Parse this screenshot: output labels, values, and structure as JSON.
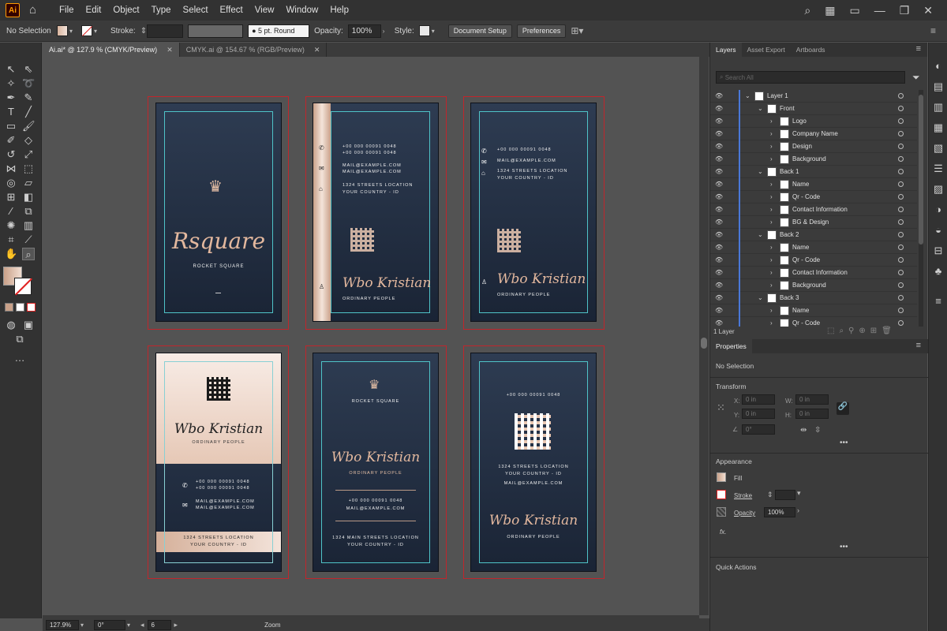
{
  "menu": {
    "items": [
      "File",
      "Edit",
      "Object",
      "Type",
      "Select",
      "Effect",
      "View",
      "Window",
      "Help"
    ],
    "logo": "Ai"
  },
  "control": {
    "selection": "No Selection",
    "stroke_label": "Stroke:",
    "brush": "5 pt. Round",
    "opacity_label": "Opacity:",
    "opacity": "100%",
    "style_label": "Style:",
    "doc_setup": "Document Setup",
    "preferences": "Preferences"
  },
  "tabs": [
    {
      "label": "Ai.ai* @ 127.9 % (CMYK/Preview)",
      "active": true
    },
    {
      "label": "CMYK.ai @ 154.67 % (RGB/Preview)",
      "active": false
    }
  ],
  "cards": {
    "brand": "Rsquare",
    "brand_sub": "ROCKET SQUARE",
    "phone1": "+00 000 00091 0048",
    "phone2": "+00 000 00091 0048",
    "mail1": "MAIL@EXAMPLE.COM",
    "mail2": "MAIL@EXAMPLE.COM",
    "addr1": "1324 STREETS LOCATION",
    "addr2": "YOUR COUNTRY - ID",
    "name": "Wbo Kristian",
    "title": "ORDINARY PEOPLE",
    "addr_main": "1324 MAIN STREETS LOCATION"
  },
  "status": {
    "zoom": "127.9%",
    "rotate": "0°",
    "artboard": "6",
    "tool": "Zoom"
  },
  "layers": {
    "tabs": [
      "Layers",
      "Asset Export",
      "Artboards"
    ],
    "search_placeholder": "Search All",
    "rows": [
      {
        "name": "Layer 1",
        "level": 0
      },
      {
        "name": "Front",
        "level": 1
      },
      {
        "name": "Logo",
        "level": 2
      },
      {
        "name": "Company Name",
        "level": 2
      },
      {
        "name": "Design",
        "level": 2
      },
      {
        "name": "Background",
        "level": 2
      },
      {
        "name": "Back 1",
        "level": 1
      },
      {
        "name": "Name",
        "level": 2
      },
      {
        "name": "Qr - Code",
        "level": 2
      },
      {
        "name": "Contact Information",
        "level": 2
      },
      {
        "name": "BG & Design",
        "level": 2
      },
      {
        "name": "Back 2",
        "level": 1
      },
      {
        "name": "Name",
        "level": 2
      },
      {
        "name": "Qr - Code",
        "level": 2
      },
      {
        "name": "Contact Information",
        "level": 2
      },
      {
        "name": "Background",
        "level": 2
      },
      {
        "name": "Back 3",
        "level": 1
      },
      {
        "name": "Name",
        "level": 2
      },
      {
        "name": "Qr - Code",
        "level": 2
      }
    ],
    "count": "1 Layer"
  },
  "properties": {
    "title": "Properties",
    "selection": "No Selection",
    "transform": "Transform",
    "x_label": "X:",
    "y_label": "Y:",
    "w_label": "W:",
    "h_label": "H:",
    "x": "0 in",
    "y": "0 in",
    "w": "0 in",
    "h": "0 in",
    "angle": "0°",
    "appearance": "Appearance",
    "fill": "Fill",
    "stroke": "Stroke",
    "opacity_label": "Opacity",
    "opacity": "100%",
    "fx": "fx.",
    "quick": "Quick Actions"
  }
}
